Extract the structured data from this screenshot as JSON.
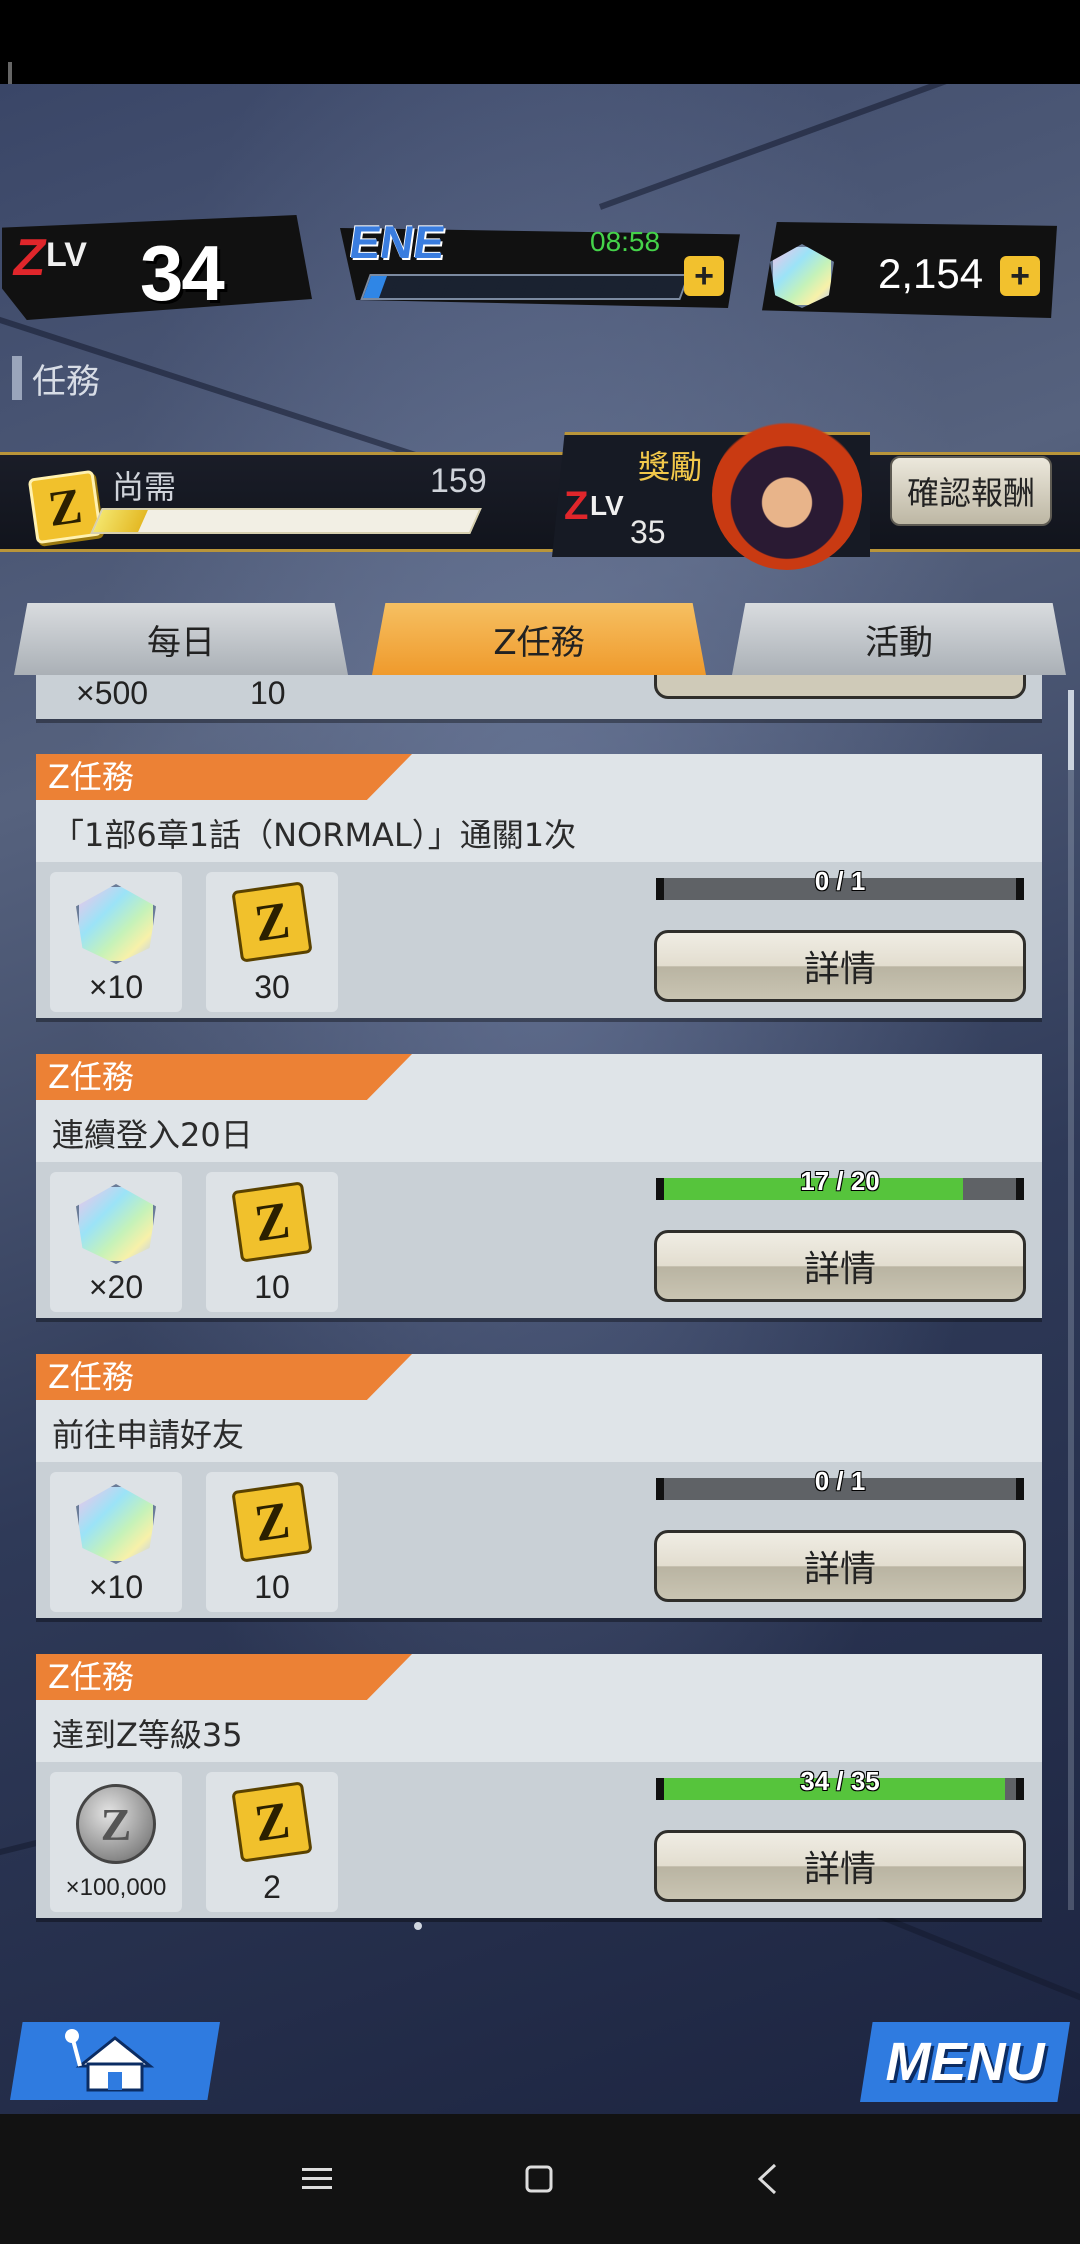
{
  "header": {
    "zlv_z": "Z",
    "zlv_lv": "LV",
    "zlv_value": "34",
    "ene_label": "ENE",
    "ene_timer": "08:58",
    "ene_fill_fraction": 0.05,
    "ene_plus": "+",
    "gem_count": "2,154",
    "gem_plus": "+"
  },
  "section": {
    "title": "任務"
  },
  "progress_banner": {
    "z_token": "Z",
    "need_label": "尚需",
    "need_value": "159",
    "need_fill_fraction": 0.12,
    "reward_title": "獎勵",
    "reward_z": "Z",
    "reward_lv": "LV",
    "reward_level": "35",
    "confirm_label": "確認報酬"
  },
  "tabs": [
    {
      "label": "每日",
      "active": false
    },
    {
      "label": "Z任務",
      "active": true
    },
    {
      "label": "活動",
      "active": false
    }
  ],
  "partial_card": {
    "qty1": "×500",
    "qty2": "10"
  },
  "missions": [
    {
      "tag": "Z任務",
      "desc": "「1部6章1話（NORMAL）」通關1次",
      "reward1_qty": "×10",
      "reward2_qty": "30",
      "progress_text": "0 / 1",
      "progress_fraction": 0,
      "button": "詳情"
    },
    {
      "tag": "Z任務",
      "desc": "連續登入20日",
      "reward1_qty": "×20",
      "reward2_qty": "10",
      "progress_text": "17 / 20",
      "progress_fraction": 0.85,
      "button": "詳情"
    },
    {
      "tag": "Z任務",
      "desc": "前往申請好友",
      "reward1_qty": "×10",
      "reward2_qty": "10",
      "progress_text": "0 / 1",
      "progress_fraction": 0,
      "button": "詳情"
    },
    {
      "tag": "Z任務",
      "desc": "達到Z等級35",
      "reward1_qty": "×100,000",
      "reward2_qty": "2",
      "progress_text": "34 / 35",
      "progress_fraction": 0.97,
      "button": "詳情"
    }
  ],
  "bottom": {
    "menu_label": "MENU"
  },
  "colors": {
    "accent_orange": "#ec8135",
    "progress_green": "#56c43c",
    "ene_blue": "#2f86e6",
    "z_gold": "#f1c12c"
  }
}
